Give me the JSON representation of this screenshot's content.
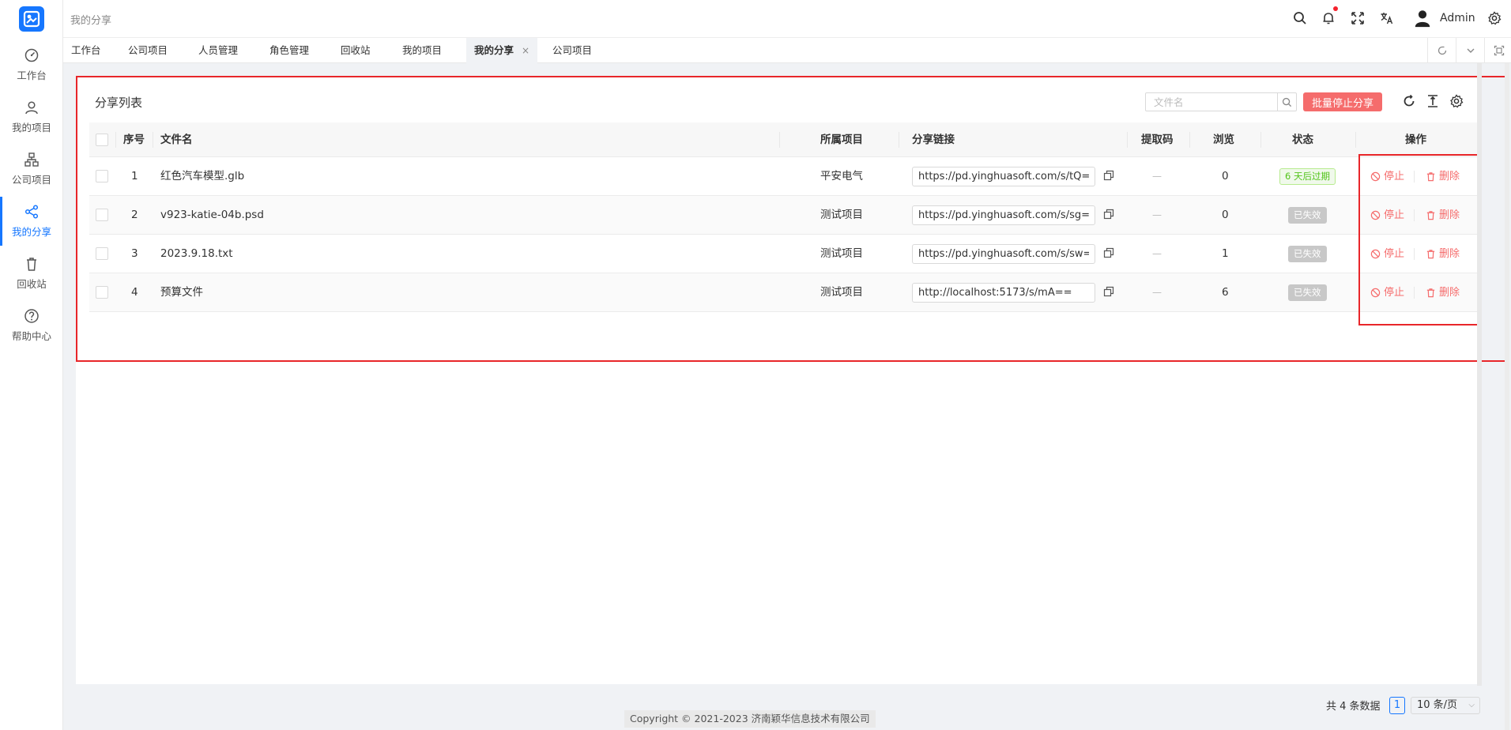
{
  "sidebar": {
    "items": [
      {
        "label": "工作台",
        "icon": "dashboard-icon"
      },
      {
        "label": "我的项目",
        "icon": "user-icon"
      },
      {
        "label": "公司项目",
        "icon": "org-icon"
      },
      {
        "label": "我的分享",
        "icon": "share-icon",
        "active": true
      },
      {
        "label": "回收站",
        "icon": "trash-icon"
      },
      {
        "label": "帮助中心",
        "icon": "help-icon"
      }
    ]
  },
  "header": {
    "breadcrumb": "我的分享",
    "user_name": "Admin",
    "icons": [
      "search-icon",
      "bell-icon",
      "fullscreen-icon",
      "translate-icon",
      "avatar",
      "gear-icon"
    ]
  },
  "tabs": [
    {
      "label": "工作台"
    },
    {
      "label": "公司项目"
    },
    {
      "label": "人员管理"
    },
    {
      "label": "角色管理"
    },
    {
      "label": "回收站"
    },
    {
      "label": "我的项目"
    },
    {
      "label": "我的分享",
      "active": true,
      "close": "×"
    },
    {
      "label": "公司项目"
    }
  ],
  "card": {
    "title": "分享列表",
    "search_placeholder": "文件名",
    "batch_button": "批量停止分享"
  },
  "table": {
    "headers": {
      "index": "序号",
      "filename": "文件名",
      "project": "所属项目",
      "link": "分享链接",
      "code": "提取码",
      "views": "浏览",
      "status": "状态",
      "actions": "操作"
    },
    "rows": [
      {
        "index": "1",
        "filename": "红色汽车模型.glb",
        "project": "平安电气",
        "link": "https://pd.yinghuasoft.com/s/tQ==",
        "code": "—",
        "views": "0",
        "status": "6 天后过期",
        "status_type": "green"
      },
      {
        "index": "2",
        "filename": "v923-katie-04b.psd",
        "project": "测试项目",
        "link": "https://pd.yinghuasoft.com/s/sg==",
        "code": "—",
        "views": "0",
        "status": "已失效",
        "status_type": "gray"
      },
      {
        "index": "3",
        "filename": "2023.9.18.txt",
        "project": "测试项目",
        "link": "https://pd.yinghuasoft.com/s/sw==",
        "code": "—",
        "views": "1",
        "status": "已失效",
        "status_type": "gray"
      },
      {
        "index": "4",
        "filename": "预算文件",
        "project": "测试项目",
        "link": "http://localhost:5173/s/mA==",
        "code": "—",
        "views": "6",
        "status": "已失效",
        "status_type": "gray"
      }
    ],
    "action_stop": "停止",
    "action_delete": "删除"
  },
  "pagination": {
    "total": "共 4 条数据",
    "current_page": "1",
    "page_size": "10 条/页"
  },
  "footer": {
    "copyright": "Copyright © 2021-2023 济南颖华信息技术有限公司"
  },
  "colors": {
    "primary": "#1677ff",
    "danger": "#f56c6c",
    "highlight": "#e8262a"
  }
}
